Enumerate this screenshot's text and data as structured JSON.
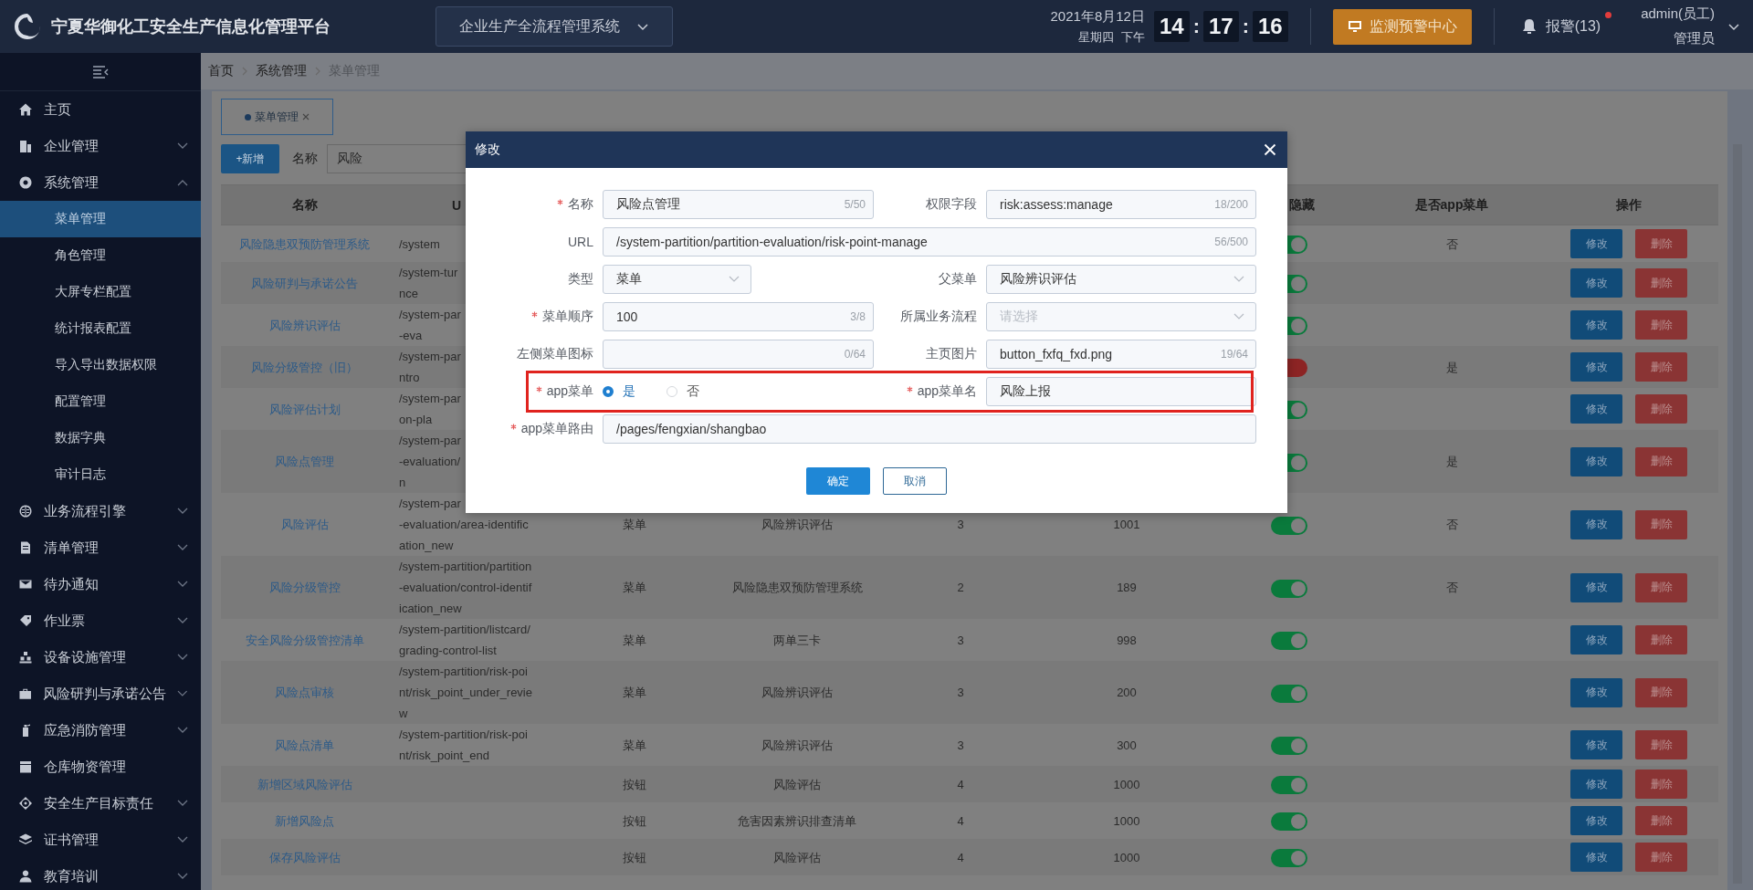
{
  "header": {
    "title": "宁夏华御化工安全生产信息化管理平台",
    "system_select": "企业生产全流程管理系统",
    "date": "2021年8月12日",
    "weekday": "星期四",
    "period": "下午",
    "clock": [
      {
        "kind": "digits",
        "text": "14"
      },
      {
        "kind": "sep",
        "text": ":"
      },
      {
        "kind": "digits",
        "text": "17"
      },
      {
        "kind": "sep",
        "text": ":"
      },
      {
        "kind": "digits",
        "text": "16"
      }
    ],
    "monitor_button": "监测预警中心",
    "alarm": "报警(13)",
    "alarm_unread": true,
    "user": "admin(员工)",
    "role": "管理员"
  },
  "sidebar": {
    "items": [
      {
        "label": "主页",
        "kind": "link",
        "selected": false
      },
      {
        "label": "企业管理",
        "kind": "group",
        "expanded": false,
        "selected": false
      },
      {
        "label": "系统管理",
        "kind": "group",
        "expanded": true,
        "selected": false,
        "children": [
          {
            "label": "菜单管理",
            "selected": true
          },
          {
            "label": "角色管理",
            "selected": false
          },
          {
            "label": "大屏专栏配置",
            "selected": false
          },
          {
            "label": "统计报表配置",
            "selected": false
          },
          {
            "label": "导入导出数据权限",
            "selected": false
          },
          {
            "label": "配置管理",
            "selected": false
          },
          {
            "label": "数据字典",
            "selected": false
          },
          {
            "label": "审计日志",
            "selected": false
          }
        ]
      },
      {
        "label": "业务流程引擎",
        "kind": "group",
        "expanded": false,
        "selected": false
      },
      {
        "label": "清单管理",
        "kind": "group",
        "expanded": false,
        "selected": false
      },
      {
        "label": "待办通知",
        "kind": "group",
        "expanded": false,
        "selected": false
      },
      {
        "label": "作业票",
        "kind": "group",
        "expanded": false,
        "selected": false
      },
      {
        "label": "设备设施管理",
        "kind": "group",
        "expanded": false,
        "selected": false
      },
      {
        "label": "风险研判与承诺公告",
        "kind": "group",
        "expanded": false,
        "selected": false
      },
      {
        "label": "应急消防管理",
        "kind": "group",
        "expanded": false,
        "selected": false
      },
      {
        "label": "仓库物资管理",
        "kind": "link",
        "selected": false
      },
      {
        "label": "安全生产目标责任",
        "kind": "group",
        "expanded": false,
        "selected": false
      },
      {
        "label": "证书管理",
        "kind": "group",
        "expanded": false,
        "selected": false
      },
      {
        "label": "教育培训",
        "kind": "group",
        "expanded": false,
        "selected": false
      }
    ]
  },
  "breadcrumb": [
    "首页",
    "系统管理",
    "菜单管理"
  ],
  "tabs": [
    {
      "label": "菜单管理",
      "selected": true
    }
  ],
  "toolbar": {
    "add_button": "+新增",
    "filter_label": "名称",
    "filter_value": "风险"
  },
  "table": {
    "columns": [
      "名称",
      "U",
      "",
      "",
      "",
      "",
      "隐藏",
      "是否app菜单",
      "操作"
    ],
    "rows": [
      {
        "name": "风险隐患双预防管理系统",
        "url": "/system",
        "switch_on": true,
        "app": "否",
        "actions": [
          "修改",
          "删除"
        ]
      },
      {
        "name": "风险研判与承诺公告",
        "url": "/system-tur\nnce",
        "switch_on": true,
        "actions": [
          "修改",
          "删除"
        ]
      },
      {
        "name": "风险辨识评估",
        "url": "/system-par\n-eva",
        "switch_on": true,
        "actions": [
          "修改",
          "删除"
        ]
      },
      {
        "name": "风险分级管控（旧）",
        "url": "/system-par\nntro",
        "switch_on": false,
        "app": "是",
        "actions": [
          "修改",
          "删除"
        ]
      },
      {
        "name": "风险评估计划",
        "url": "/system-par\non-pla",
        "switch_on": true,
        "actions": [
          "修改",
          "删除"
        ]
      },
      {
        "name": "风险点管理",
        "url": "/system-par\n-evaluation/\nn",
        "switch_on": true,
        "app": "是",
        "actions": [
          "修改",
          "删除"
        ]
      },
      {
        "name": "风险评估",
        "url": "/system-par\n-evaluation/area-identific\nation_new",
        "type": "菜单",
        "parent": "风险辨识评估",
        "level": "3",
        "order": "1001",
        "switch_on": true,
        "app": "否",
        "actions": [
          "修改",
          "删除"
        ]
      },
      {
        "name": "风险分级管控",
        "url": "/system-partition/partition\n-evaluation/control-identif\nication_new",
        "type": "菜单",
        "parent": "风险隐患双预防管理系统",
        "level": "2",
        "order": "189",
        "switch_on": true,
        "app": "否",
        "actions": [
          "修改",
          "删除"
        ]
      },
      {
        "name": "安全风险分级管控清单",
        "url": "/system-partition/listcard/\ngrading-control-list",
        "type": "菜单",
        "parent": "两单三卡",
        "level": "3",
        "order": "998",
        "switch_on": true,
        "actions": [
          "修改",
          "删除"
        ]
      },
      {
        "name": "风险点审核",
        "url": "/system-partition/risk-poi\nnt/risk_point_under_revie\nw",
        "type": "菜单",
        "parent": "风险辨识评估",
        "level": "3",
        "order": "200",
        "switch_on": true,
        "actions": [
          "修改",
          "删除"
        ]
      },
      {
        "name": "风险点清单",
        "url": "/system-partition/risk-poi\nnt/risk_point_end",
        "type": "菜单",
        "parent": "风险辨识评估",
        "level": "3",
        "order": "300",
        "switch_on": true,
        "actions": [
          "修改",
          "删除"
        ]
      },
      {
        "name": "新增区域风险评估",
        "type": "按钮",
        "parent": "风险评估",
        "level": "4",
        "order": "1000",
        "switch_on": true,
        "actions": [
          "修改",
          "删除"
        ]
      },
      {
        "name": "新增风险点",
        "type": "按钮",
        "parent": "危害因素辨识排查清单",
        "level": "4",
        "order": "1000",
        "switch_on": true,
        "actions": [
          "修改",
          "删除"
        ]
      },
      {
        "name": "保存风险评估",
        "type": "按钮",
        "parent": "风险评估",
        "level": "4",
        "order": "1000",
        "switch_on": true,
        "actions": [
          "修改",
          "删除"
        ]
      }
    ]
  },
  "dialog": {
    "title": "修改",
    "rows": [
      {
        "highlighted": false,
        "fields": [
          {
            "kind": "input",
            "label": "名称",
            "required": true,
            "value": "风险点管理",
            "count": "5/50"
          },
          {
            "kind": "input",
            "label": "权限字段",
            "required": false,
            "value": "risk:assess:manage",
            "count": "18/200"
          }
        ]
      },
      {
        "highlighted": false,
        "fields": [
          {
            "kind": "input",
            "label": "URL",
            "required": false,
            "value": "/system-partition/partition-evaluation/risk-point-manage",
            "count": "56/500"
          }
        ]
      },
      {
        "highlighted": false,
        "fields": [
          {
            "kind": "select",
            "label": "类型",
            "required": false,
            "value": "菜单"
          },
          {
            "kind": "select",
            "label": "父菜单",
            "required": false,
            "value": "风险辨识评估"
          }
        ]
      },
      {
        "highlighted": false,
        "fields": [
          {
            "kind": "input",
            "label": "菜单顺序",
            "required": true,
            "value": "100",
            "count": "3/8"
          },
          {
            "kind": "select",
            "label": "所属业务流程",
            "required": false,
            "placeholder": "请选择"
          }
        ]
      },
      {
        "highlighted": false,
        "fields": [
          {
            "kind": "input",
            "label": "左侧菜单图标",
            "required": false,
            "count": "0/64"
          },
          {
            "kind": "input",
            "label": "主页图片",
            "required": false,
            "value": "button_fxfq_fxd.png",
            "count": "19/64"
          }
        ]
      },
      {
        "highlighted": true,
        "fields": [
          {
            "kind": "radio",
            "label": "app菜单",
            "required": true,
            "options": [
              {
                "label": "是",
                "selected": true
              },
              {
                "label": "否",
                "selected": false
              }
            ]
          },
          {
            "kind": "input",
            "label": "app菜单名",
            "required": true,
            "value": "风险上报"
          }
        ]
      },
      {
        "highlighted": false,
        "fields": [
          {
            "kind": "input",
            "label": "app菜单路由",
            "required": true,
            "value": "/pages/fengxian/shangbao"
          }
        ]
      }
    ],
    "buttons": [
      {
        "label": "确定",
        "kind": "primary"
      },
      {
        "label": "取消",
        "kind": "default"
      }
    ]
  }
}
